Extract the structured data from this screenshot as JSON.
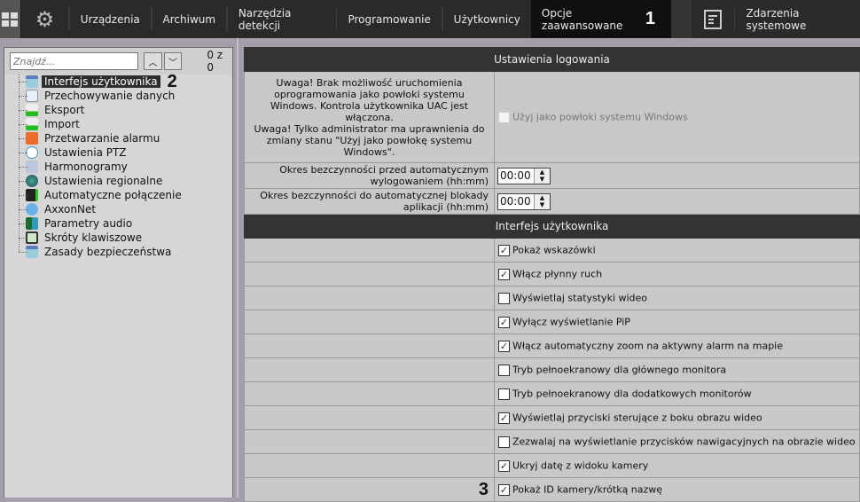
{
  "topbar": {
    "menu": [
      "Urządzenia",
      "Archiwum",
      "Narzędzia detekcji",
      "Programowanie",
      "Użytkownicy",
      "Opcje zaawansowane",
      "Zdarzenia systemowe"
    ],
    "active": "Opcje zaawansowane",
    "annotation": "1"
  },
  "sidebar": {
    "search_placeholder": "Znajdź...",
    "count": "0 z 0",
    "annotation": "2",
    "items": [
      "Interfejs użytkownika",
      "Przechowywanie danych",
      "Eksport",
      "Import",
      "Przetwarzanie alarmu",
      "Ustawienia PTZ",
      "Harmonogramy",
      "Ustawienia regionalne",
      "Automatyczne połączenie",
      "AxxonNet",
      "Parametry audio",
      "Skróty klawiszowe",
      "Zasady bezpieczeństwa"
    ],
    "selected": "Interfejs użytkownika"
  },
  "login": {
    "title": "Ustawienia logowania",
    "warning1": "Uwaga! Brak możliwość uruchomienia oprogramowania jako powłoki systemu Windows. Kontrola użytkownika UAC jest włączona.",
    "warning2": "Uwaga! Tylko administrator ma uprawnienia do zmiany stanu \"Użyj jako powłokę systemu Windows\".",
    "shell_label": "Użyj jako powłoki systemu Windows",
    "logout_label": "Okres bezczynności przed automatycznym wylogowaniem (hh:mm)",
    "logout_value": "00:00",
    "lock_label": "Okres bezczynności do automatycznej blokady aplikacji (hh:mm)",
    "lock_value": "00:00"
  },
  "ui": {
    "title": "Interfejs użytkownika",
    "annotation": "3",
    "options": [
      {
        "label": "Pokaż wskazówki",
        "checked": true
      },
      {
        "label": "Włącz płynny ruch",
        "checked": true
      },
      {
        "label": "Wyświetlaj statystyki wideo",
        "checked": false
      },
      {
        "label": "Wyłącz wyświetlanie PiP",
        "checked": true
      },
      {
        "label": "Włącz automatyczny zoom na aktywny alarm na mapie",
        "checked": true
      },
      {
        "label": "Tryb pełnoekranowy dla głównego monitora",
        "checked": false
      },
      {
        "label": "Tryb pełnoekranowy dla dodatkowych monitorów",
        "checked": false
      },
      {
        "label": "Wyświetlaj przyciski sterujące z boku obrazu wideo",
        "checked": true
      },
      {
        "label": "Zezwalaj na wyświetlanie przycisków nawigacyjnych na obrazie wideo",
        "checked": false
      },
      {
        "label": "Ukryj datę z widoku kamery",
        "checked": true
      },
      {
        "label": "Pokaż ID kamery/krótką nazwę",
        "checked": true
      }
    ]
  }
}
